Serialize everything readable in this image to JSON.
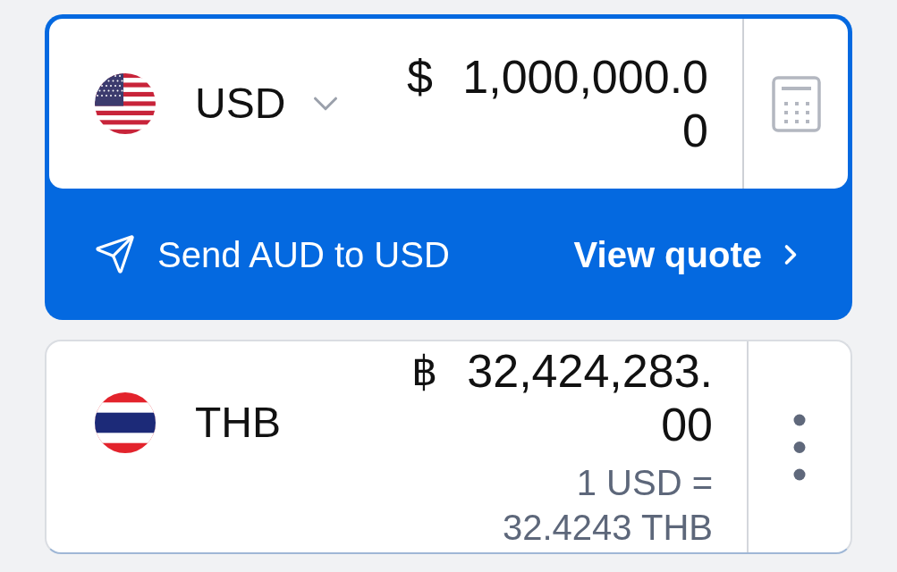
{
  "source": {
    "currency_code": "USD",
    "currency_symbol": "$",
    "amount": "1,000,000.00"
  },
  "send_banner": {
    "label": "Send AUD to USD",
    "action": "View quote"
  },
  "target": {
    "currency_code": "THB",
    "currency_symbol": "฿",
    "amount": "32,424,283.00",
    "rate": "1 USD = 32.4243 THB"
  }
}
